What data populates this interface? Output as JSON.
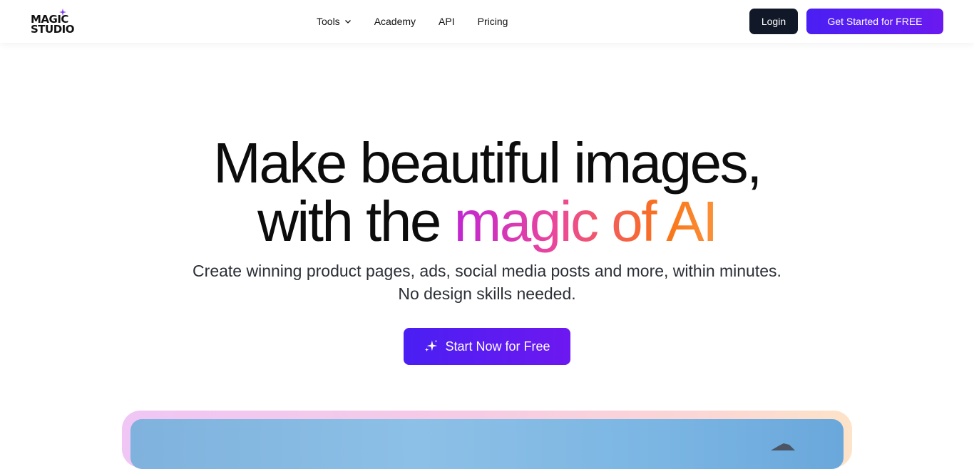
{
  "header": {
    "logo": {
      "line1": "MAGIC",
      "line2": "STUDIO",
      "icon": "sparkle-icon"
    },
    "nav": [
      {
        "label": "Tools",
        "has_dropdown": true
      },
      {
        "label": "Academy"
      },
      {
        "label": "API"
      },
      {
        "label": "Pricing"
      }
    ],
    "login_label": "Login",
    "cta_label": "Get Started for FREE"
  },
  "hero": {
    "title_line1": "Make beautiful images,",
    "title_line2_plain": "with the",
    "title_line2_gradient": "magic of AI",
    "subtitle_line1": "Create winning product pages, ads, social media posts and more, within minutes.",
    "subtitle_line2": "No design skills needed.",
    "button_label": "Start Now for Free",
    "button_icon": "sparkles-icon"
  },
  "colors": {
    "brand_purple": "#4a1ff3",
    "dark_button": "#111827",
    "gradient_start": "#c026d3",
    "gradient_end": "#f97316"
  }
}
